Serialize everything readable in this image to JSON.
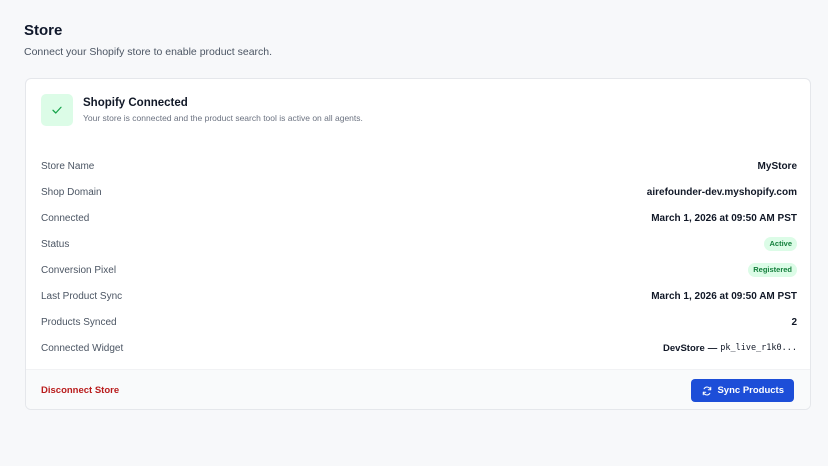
{
  "page": {
    "title": "Store",
    "subtitle": "Connect your Shopify store to enable product search."
  },
  "connection": {
    "icon": "check-icon",
    "title": "Shopify Connected",
    "description": "Your store is connected and the product search tool is active on all agents."
  },
  "details": {
    "store_name": {
      "label": "Store Name",
      "value": "MyStore"
    },
    "shop_domain": {
      "label": "Shop Domain",
      "value": "airefounder-dev.myshopify.com"
    },
    "connected": {
      "label": "Connected",
      "value": "March 1, 2026 at 09:50 AM PST"
    },
    "status": {
      "label": "Status",
      "value": "Active"
    },
    "conversion_pixel": {
      "label": "Conversion Pixel",
      "value": "Registered"
    },
    "last_product_sync": {
      "label": "Last Product Sync",
      "value": "March 1, 2026 at 09:50 AM PST"
    },
    "products_synced": {
      "label": "Products Synced",
      "value": "2"
    },
    "connected_widget": {
      "label": "Connected Widget",
      "name": "DevStore",
      "separator": "—",
      "key": "pk_live_r1k0..."
    }
  },
  "footer": {
    "disconnect_label": "Disconnect Store",
    "sync_label": "Sync Products",
    "sync_icon": "refresh-icon"
  },
  "colors": {
    "accent": "#1d4ed8",
    "success_bg": "#dcfce7",
    "success_text": "#15803d",
    "danger": "#b91c1c"
  }
}
